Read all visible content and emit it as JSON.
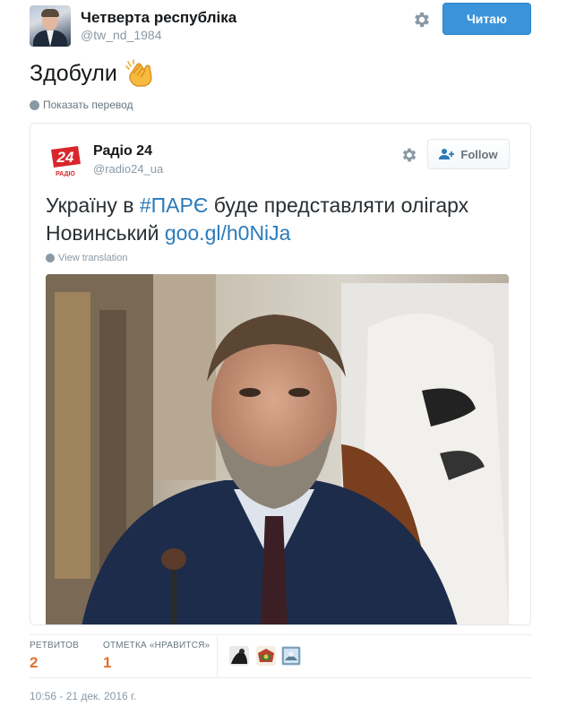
{
  "author": {
    "name": "Четверта республіка",
    "handle": "@tw_nd_1984",
    "follow_label": "Читаю",
    "avatar_icon": "user-avatar-photo"
  },
  "tweet": {
    "text": "Здобули",
    "emoji_icon": "clapping-hands-icon",
    "translate_label": "Показать перевод"
  },
  "quoted": {
    "name": "Радіо 24",
    "handle": "@radio24_ua",
    "logo_text": "24",
    "logo_subtext": "РАДІО",
    "follow_label": "Follow",
    "text_before": "Україну в ",
    "hashtag": "#ПАРЄ",
    "text_middle": " буде представляти олігарх Новинський ",
    "link": "goo.gl/h0NiJa",
    "translate_label": "View translation",
    "photo_icon": "news-photo-man-in-suit"
  },
  "stats": {
    "retweets_label": "РЕТВИТОВ",
    "retweets_value": "2",
    "likes_label": "ОТМЕТКА «НРАВИТСЯ»",
    "likes_value": "1"
  },
  "timestamp": "10:56 - 21 дек. 2016 г.",
  "colors": {
    "primary_blue": "#3b94d9",
    "link_blue": "#2b7bb9",
    "stat_orange": "#e0712f",
    "muted_gray": "#8899a6",
    "logo_red": "#d9262b"
  }
}
